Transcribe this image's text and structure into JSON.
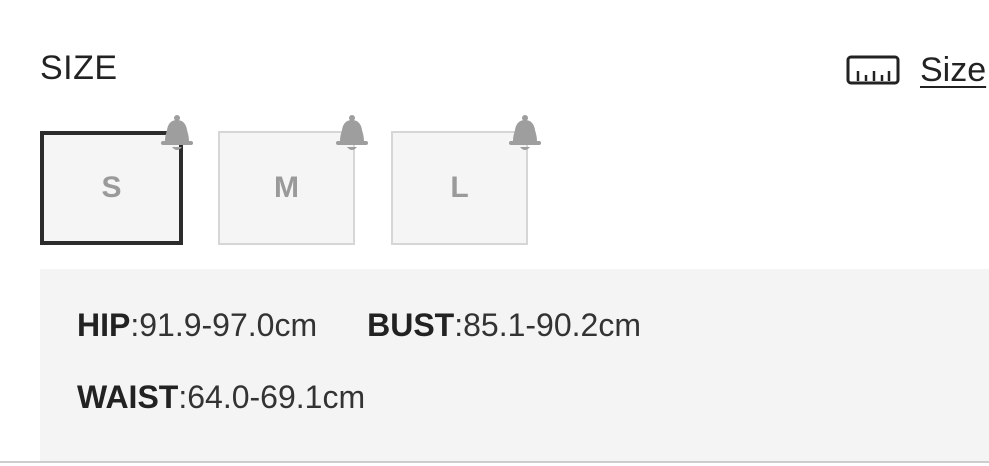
{
  "section": {
    "title": "SIZE"
  },
  "size_guide": {
    "label": "Size",
    "icon": "ruler-icon"
  },
  "size_options": [
    {
      "label": "S",
      "selected": true,
      "notify_icon": "bell-icon"
    },
    {
      "label": "M",
      "selected": false,
      "notify_icon": "bell-icon"
    },
    {
      "label": "L",
      "selected": false,
      "notify_icon": "bell-icon"
    }
  ],
  "measurements": {
    "hip": {
      "key": "HIP",
      "value": ":91.9-97.0cm"
    },
    "bust": {
      "key": "BUST",
      "value": ":85.1-90.2cm"
    },
    "waist": {
      "key": "WAIST",
      "value": ":64.0-69.1cm"
    }
  },
  "colors": {
    "selected_border": "#2c2c2c",
    "option_border": "#d6d6d6",
    "option_background": "#f5f5f5",
    "option_text": "#9a9a9a",
    "bell": "#9e9e9e",
    "panel_background": "#f4f4f4"
  }
}
